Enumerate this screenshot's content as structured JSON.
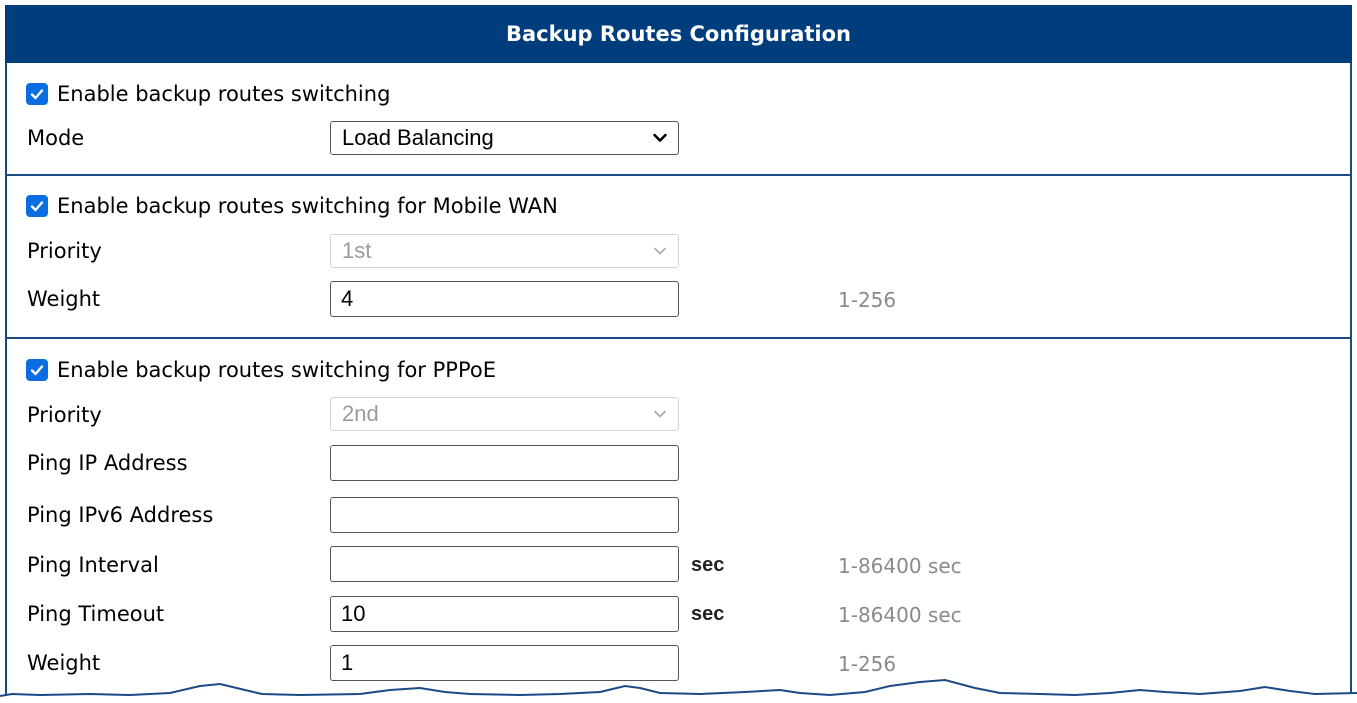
{
  "header": {
    "title": "Backup Routes Configuration"
  },
  "section_general": {
    "enable_label": "Enable backup routes switching",
    "enable_checked": true,
    "mode_label": "Mode",
    "mode_value": "Load Balancing"
  },
  "section_mobile_wan": {
    "enable_label": "Enable backup routes switching for Mobile WAN",
    "enable_checked": true,
    "priority_label": "Priority",
    "priority_value": "1st",
    "weight_label": "Weight",
    "weight_value": "4",
    "weight_hint": "1-256"
  },
  "section_pppoe": {
    "enable_label": "Enable backup routes switching for PPPoE",
    "enable_checked": true,
    "priority_label": "Priority",
    "priority_value": "2nd",
    "ping_ip_label": "Ping IP Address",
    "ping_ip_value": "",
    "ping_ipv6_label": "Ping IPv6 Address",
    "ping_ipv6_value": "",
    "ping_interval_label": "Ping Interval",
    "ping_interval_value": "",
    "ping_interval_unit": "sec",
    "ping_interval_hint": "1-86400 sec",
    "ping_timeout_label": "Ping Timeout",
    "ping_timeout_value": "10",
    "ping_timeout_unit": "sec",
    "ping_timeout_hint": "1-86400 sec",
    "weight_label": "Weight",
    "weight_value": "1",
    "weight_hint": "1-256"
  },
  "colors": {
    "header_bg": "#003d7c",
    "checkbox_blue": "#0a6de0",
    "border_blue": "#1c4a86",
    "hint_gray": "#8a8a8a"
  }
}
